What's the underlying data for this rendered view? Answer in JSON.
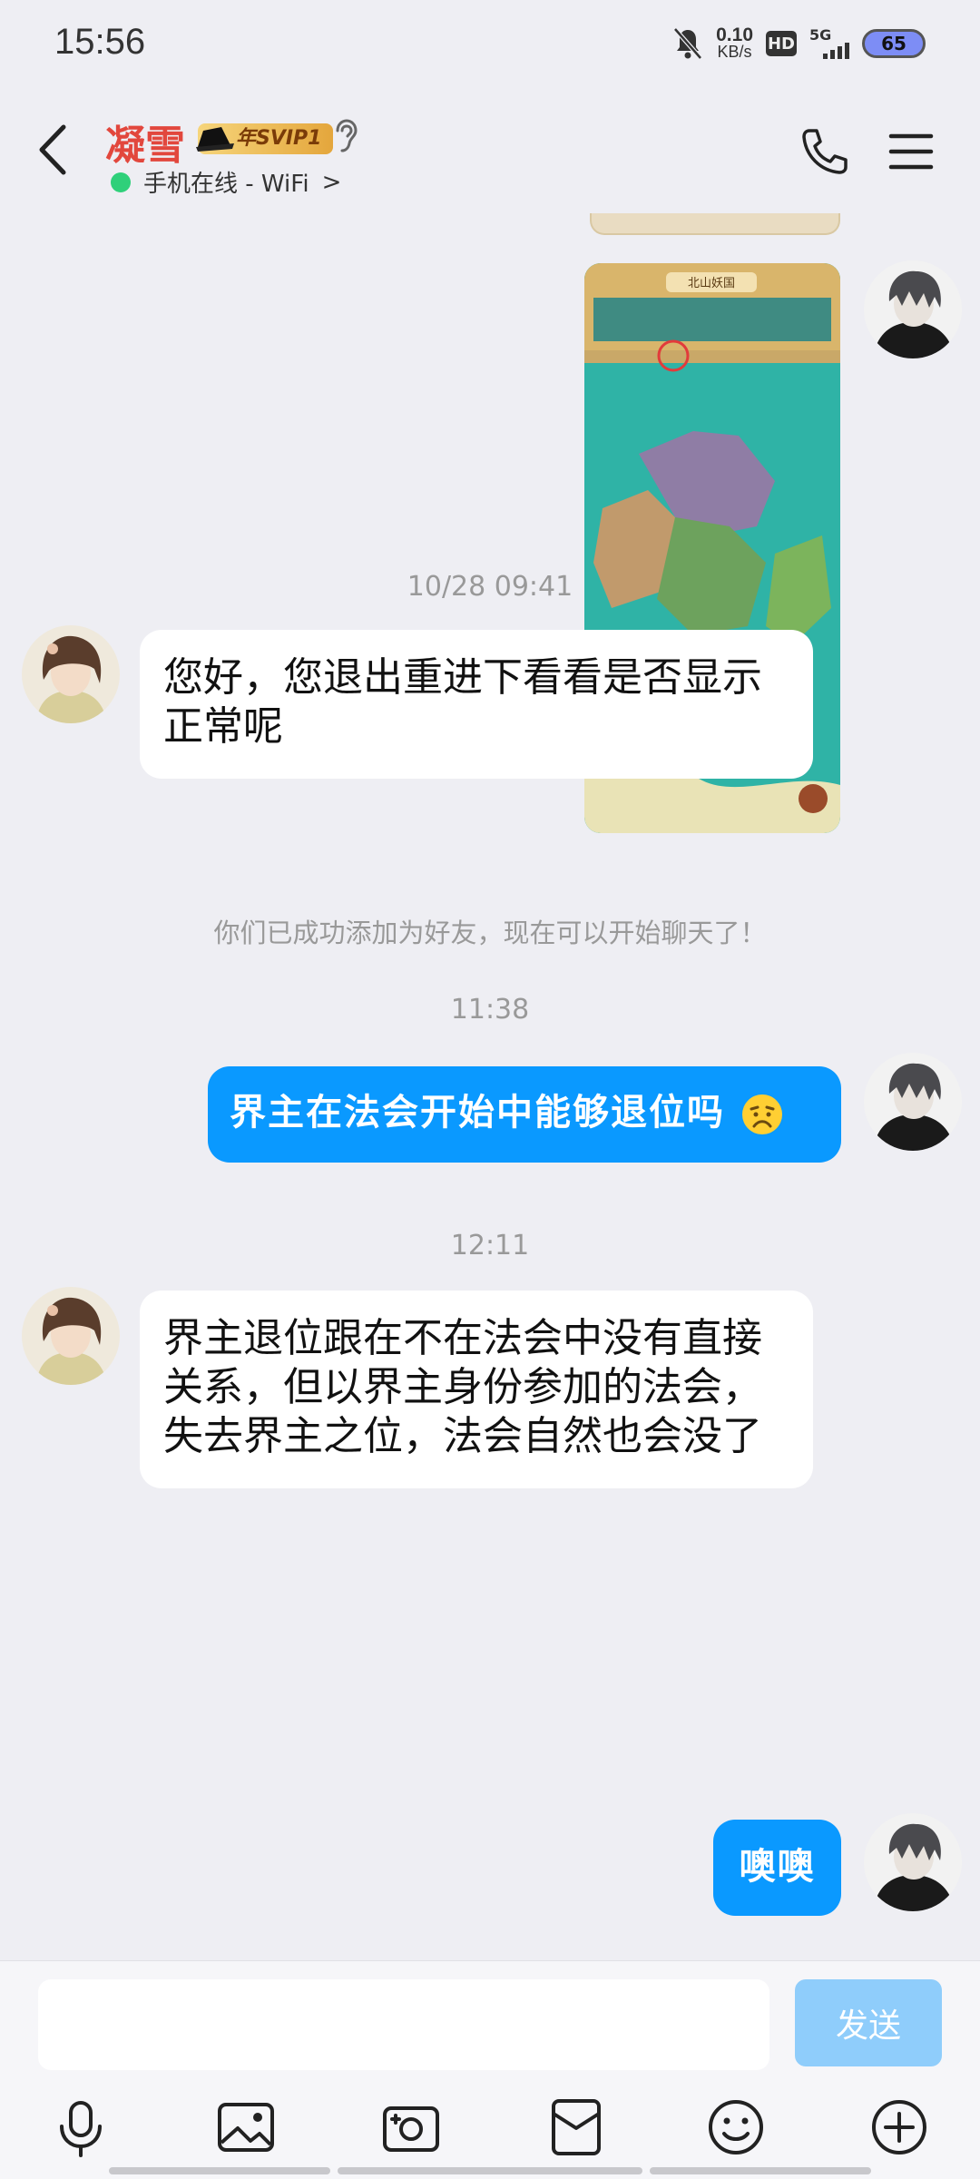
{
  "status_bar": {
    "time": "15:56",
    "net_speed": "0.10",
    "net_unit": "KB/s",
    "hd": "HD",
    "network": "5G",
    "battery": "65"
  },
  "header": {
    "contact_name": "凝雪",
    "vip_badge": "年SVIP1",
    "online_status": "手机在线 - WiFi",
    "online_chevron": ">"
  },
  "messages": [
    {
      "type": "image",
      "from": "self",
      "image_texts": [
        "北山妖国"
      ]
    },
    {
      "type": "timestamp",
      "text": "10/28 09:41"
    },
    {
      "type": "text",
      "from": "other",
      "text": "您好，您退出重进下看看是否显示正常呢"
    },
    {
      "type": "system",
      "text": "你们已成功添加为好友，现在可以开始聊天了！"
    },
    {
      "type": "timestamp",
      "text": "11:38"
    },
    {
      "type": "text",
      "from": "self",
      "text": "界主在法会开始中能够退位吗",
      "emoji": "sad-face"
    },
    {
      "type": "timestamp",
      "text": "12:11"
    },
    {
      "type": "text",
      "from": "other",
      "text": "界主退位跟在不在法会中没有直接关系，但以界主身份参加的法会，失去界主之位，法会自然也会没了"
    },
    {
      "type": "text",
      "from": "self",
      "text": "噢噢"
    }
  ],
  "composer": {
    "input_value": "",
    "send_label": "发送"
  },
  "toolbar": {
    "items": [
      "microphone-icon",
      "image-icon",
      "camera-icon",
      "red-packet-icon",
      "emoji-icon",
      "plus-icon"
    ]
  },
  "colors": {
    "accent": "#0a99ff",
    "name_red": "#e2473d",
    "online_green": "#2fd07a",
    "background": "#eeeef3"
  }
}
